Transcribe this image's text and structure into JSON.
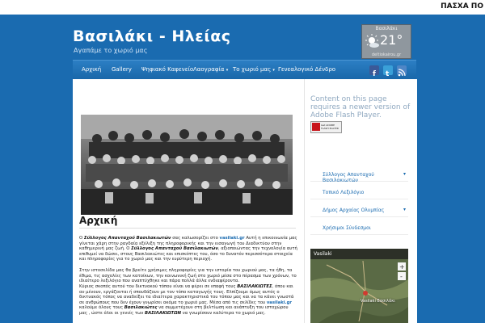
{
  "ticker": {
    "text": "ΠΑΣΧΑ ΠΟ"
  },
  "site": {
    "title": "Βασιλάκι - Ηλείας",
    "tagline": "Αγαπάμε το χωριό μας"
  },
  "weather": {
    "city": "Βασιλάκι",
    "temp": "21°",
    "unit": "c",
    "site": "deltiokairou.gr",
    "icon": "sun-cloud-icon"
  },
  "nav": {
    "items": [
      {
        "label": "Αρχική"
      },
      {
        "label": "Gallery"
      },
      {
        "label": "Ψηφιακό Καφενείο"
      },
      {
        "label": "Λαογραφία",
        "has_sub": true
      },
      {
        "label": "Το χωριό μας",
        "has_sub": true
      },
      {
        "label": "Γενεαλογικό Δένδρο"
      }
    ],
    "social": [
      "facebook-icon",
      "twitter-icon",
      "rss-icon"
    ]
  },
  "main": {
    "page_title": "Αρχική",
    "paragraphs": [
      {
        "pre": "Ο ",
        "b1": "Σύλλογος Απανταχού Βασιλακιωτών",
        "mid": " σας καλωσορίζει στο ",
        "link": "vasilaki.gr",
        "post": " Αυτή η επικοινωνία μας γίνεται χάρη στην ραγδαία εξέλιξη της πληροφορικής  και την εισαγωγή του Διαδικτύου στην καθημερινή μας ζωή. Ο "
      },
      {
        "b": "Σύλλογος Απανταχού Βασιλακιωτών",
        "text": ", αξιοποιώντας την τεχνολογία αυτή επιθυμεί να δώσει, στους Βασιλακιώτες και επισκέπτες του, όσο το δυνατόν περισσότερα στοιχεία και πληροφορίες για το χωριό μας και την ευρύτερη περιοχή."
      },
      {
        "text": "Στην ιστοσελίδα μας θα βρείτε χρήσιμες πληροφορίες για την ιστορία του χωριού μας, τα ήθη, τα έθιμα, τις ασχολίες των κατοίκων, την κοινωνική ζωή στο χωριό μέσα στο πέρασμα των χρόνων, το ιδιαίτερο λεξιλόγιο που αναπτύχθηκε και πάρα πολλά άλλα ενδιαφέροντα."
      },
      {
        "pre": "Κύριος σκοπός αυτού του δικτυακού τόπου είναι να φέρει σε επαφή τους ",
        "b": "ΒΑΣΙΛΑΚΙΩΤΕΣ",
        "post": ", όπου και αν μένουν, εργάζονται ή σπουδάζουν με τον τόπο καταγωγής τους. Ελπίζουμε όμως αυτός ο δικτυακός τόπος να αναδείξει τα ιδιαίτερα χαρακτηριστικά του τόπου μας και να τα κάνει γνωστά σε ανθρώπους που δεν έχουν γνωρίσει ακόμα το χωριό μας. Μέσα από τις σελίδες του "
      },
      {
        "link": "vasilaki.gr",
        "pre": " καλούμε όλους τους ",
        "b": "Βασιλακιώτες",
        "post": " να συμμετέχουν στη βελτίωση και ανάπτυξη του ιστοχώρου μας , ώστε όλοι οι γενιές των "
      },
      {
        "b": "ΒΑΣΙΛΑΚΙΩΤΩΝ",
        "post": " να γνωρίσουν καλύτερα το χωριό μας."
      }
    ]
  },
  "sidebar": {
    "flash_message": "Content on this page requires a newer version of Adobe Flash Player.",
    "flash_button": {
      "line1": "Get ADOBE",
      "line2": "FLASH PLAYER"
    },
    "links": [
      {
        "label": "Σύλλογος Απανταχού Βασιλακιωτών",
        "has_sub": true
      },
      {
        "label": "Τοπικό Λεξιλόγιο",
        "has_sub": false
      },
      {
        "label": "Δήμος Αρχαίας Ολυμπίας",
        "has_sub": true
      },
      {
        "label": "Χρήσιμοι Σύνδεσμοι",
        "has_sub": false
      }
    ],
    "map": {
      "title": "Vasilaki",
      "label": "Vasilaki Βασιλάκι"
    }
  }
}
